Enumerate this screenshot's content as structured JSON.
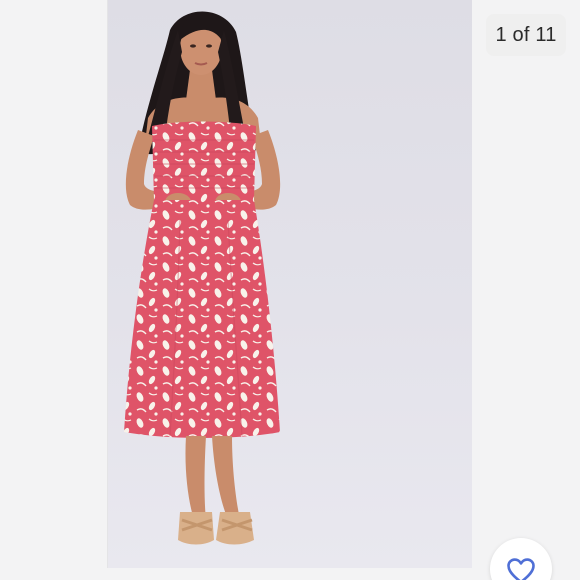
{
  "gallery": {
    "counter_text": "1 of 11",
    "current_index": 1,
    "total_images": 11
  },
  "photo": {
    "icon": "product-photo",
    "colors": {
      "backdrop": "#e1e0e8",
      "dress": "#e0576a",
      "print": "#f7f1ea",
      "skin": "#c98c6b",
      "hair": "#1e1718",
      "sandals": "#d9b08a"
    }
  },
  "actions": {
    "like_icon": "heart-outline-icon",
    "like_color": "#4f6fd6"
  }
}
